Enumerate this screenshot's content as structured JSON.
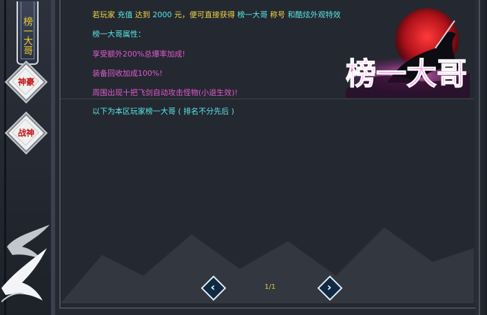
{
  "sidebar": {
    "vertical_tab": "榜一大哥",
    "buttons": [
      {
        "label": "神豪"
      },
      {
        "label": "战神"
      }
    ]
  },
  "content": {
    "intro": {
      "seg1": "若玩家",
      "seg2": "充值",
      "seg3": "达到",
      "seg4": "2000",
      "seg5": "元，便可直接获得",
      "seg6": "榜一大哥",
      "seg7": "称号",
      "seg8": "和酷炫外观特效"
    },
    "attr_title": "榜一大哥属性：",
    "attrs": [
      "享受额外200%总爆率加成!",
      "装备回收加成100%!",
      "周围出现十把飞剑自动攻击怪物(小退生效)!"
    ],
    "list_header": "以下为本区玩家榜一大哥 ( 排名不分先后 )"
  },
  "banner": {
    "title": "榜一大哥"
  },
  "pagination": {
    "indicator": "1/1",
    "prev_icon": "chevron-left-icon",
    "next_icon": "chevron-right-icon"
  },
  "colors": {
    "yellow": "#f0d64a",
    "cyan": "#58e8e8",
    "magenta": "#e25ad0",
    "red_label": "#c31212"
  }
}
